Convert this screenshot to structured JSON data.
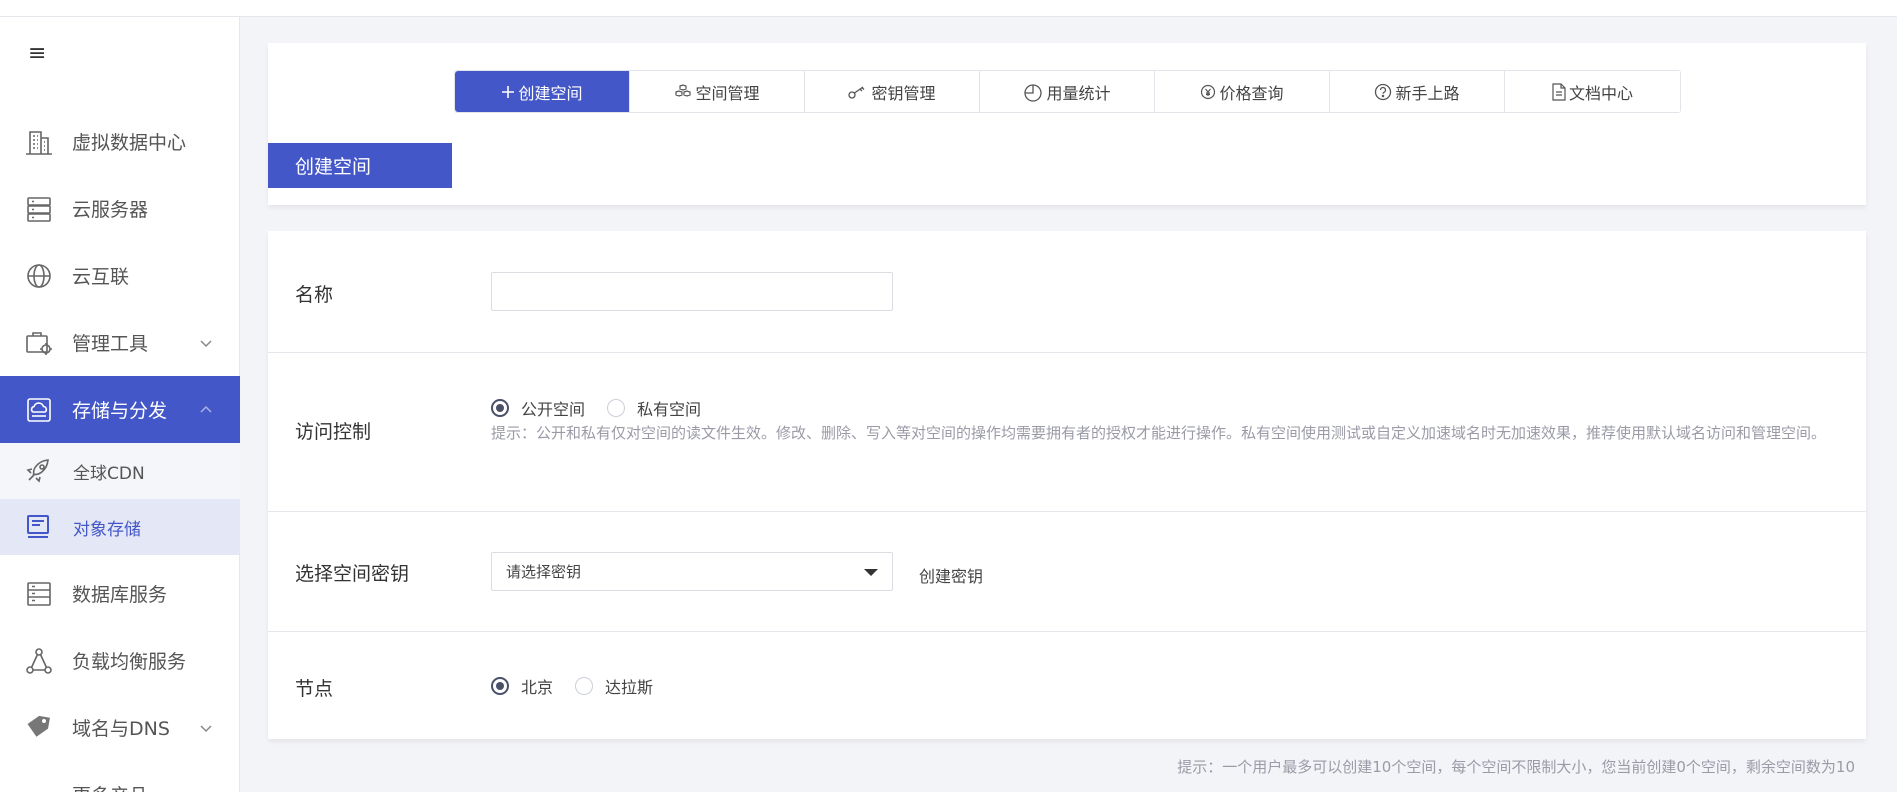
{
  "sidebar": {
    "menu_glyph": "≡",
    "items": [
      {
        "label": "虚拟数据中心",
        "icon": "building-icon"
      },
      {
        "label": "云服务器",
        "icon": "server-icon"
      },
      {
        "label": "云互联",
        "icon": "globe-icon"
      },
      {
        "label": "管理工具",
        "icon": "tools-icon"
      },
      {
        "label": "存储与分发",
        "icon": "cloud-storage-icon"
      },
      {
        "label": "数据库服务",
        "icon": "database-icon"
      },
      {
        "label": "负载均衡服务",
        "icon": "load-balance-icon"
      },
      {
        "label": "域名与DNS",
        "icon": "tag-icon"
      },
      {
        "label": "更多产品",
        "icon": "more-icon"
      }
    ],
    "sub_items": [
      {
        "label": "全球CDN",
        "icon": "rocket-icon"
      },
      {
        "label": "对象存储",
        "icon": "monitor-icon"
      }
    ],
    "accent": "#4457c8"
  },
  "tabs": [
    {
      "label": "创建空间",
      "icon": "plus-icon"
    },
    {
      "label": "空间管理",
      "icon": "cubes-icon"
    },
    {
      "label": "密钥管理",
      "icon": "key-icon"
    },
    {
      "label": "用量统计",
      "icon": "pie-icon"
    },
    {
      "label": "价格查询",
      "icon": "yen-icon"
    },
    {
      "label": "新手上路",
      "icon": "question-icon"
    },
    {
      "label": "文档中心",
      "icon": "document-icon"
    }
  ],
  "section_title": "创建空间",
  "form": {
    "name": {
      "label": "名称",
      "value": "",
      "placeholder": ""
    },
    "access": {
      "label": "访问控制",
      "options": [
        "公开空间",
        "私有空间"
      ],
      "selected": "公开空间",
      "hint": "提示：公开和私有仅对空间的读文件生效。修改、删除、写入等对空间的操作均需要拥有者的授权才能进行操作。私有空间使用测试或自定义加速域名时无加速效果，推荐使用默认域名访问和管理空间。"
    },
    "key": {
      "label": "选择空间密钥",
      "select_value": "请选择密钥",
      "create_link": "创建密钥"
    },
    "node": {
      "label": "节点",
      "options": [
        "北京",
        "达拉斯"
      ],
      "selected": "北京"
    }
  },
  "footer_hint": "提示：一个用户最多可以创建10个空间，每个空间不限制大小，您当前创建0个空间，剩余空间数为10"
}
